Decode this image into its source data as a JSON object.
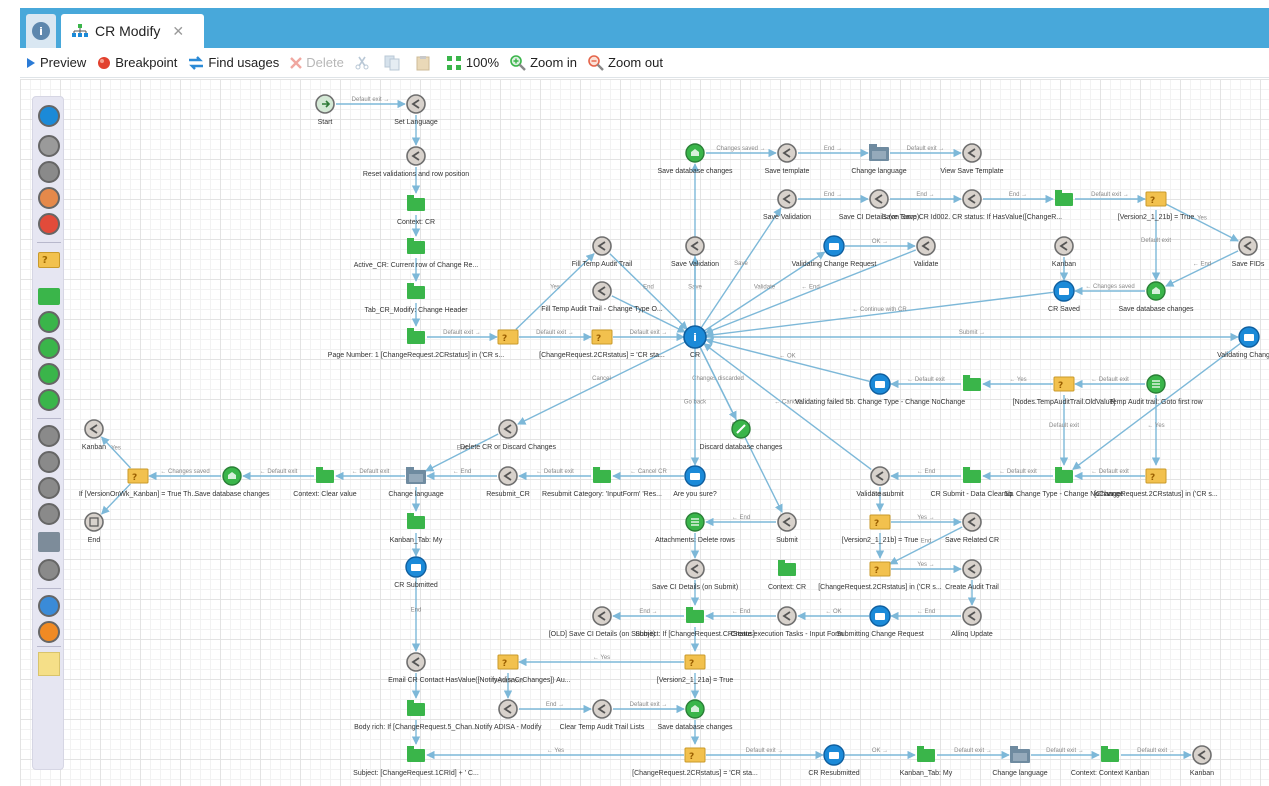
{
  "tabs": {
    "info_symbol": "i",
    "active_label": "CR Modify",
    "close_symbol": "✕"
  },
  "toolbar": {
    "preview": "Preview",
    "breakpoint": "Breakpoint",
    "find_usages": "Find usages",
    "delete": "Delete",
    "zoom_level": "100%",
    "zoom_in": "Zoom in",
    "zoom_out": "Zoom out"
  },
  "palette": {
    "items": [
      {
        "icon": "info-icon",
        "color": "#1b8ad8"
      },
      {
        "icon": "exit-icon",
        "color": "#9a9a9a"
      },
      {
        "icon": "back-icon",
        "color": "#8a8a8a"
      },
      {
        "icon": "refresh-icon",
        "color": "#e5894a"
      },
      {
        "icon": "logout-icon",
        "color": "#e24b3a"
      },
      {
        "icon": "decision-icon",
        "color": "#f2c14e"
      },
      {
        "icon": "context-icon",
        "color": "#3ab54a"
      },
      {
        "icon": "list-icon",
        "color": "#3ab54a"
      },
      {
        "icon": "loop-icon",
        "color": "#3ab54a"
      },
      {
        "icon": "database-icon",
        "color": "#3ab54a"
      },
      {
        "icon": "edit-icon",
        "color": "#3ab54a"
      },
      {
        "icon": "form-icon",
        "color": "#8a8a8a"
      },
      {
        "icon": "import-icon",
        "color": "#8a8a8a"
      },
      {
        "icon": "cloud-icon",
        "color": "#8a8a8a"
      },
      {
        "icon": "globe-icon",
        "color": "#8a8a8a"
      },
      {
        "icon": "folder-icon",
        "color": "#7d8c9a"
      },
      {
        "icon": "printer-icon",
        "color": "#8a8a8a"
      },
      {
        "icon": "link-icon",
        "color": "#3a8bd8"
      },
      {
        "icon": "wifi-icon",
        "color": "#f08a24"
      },
      {
        "icon": "note-icon",
        "color": "#f5df88"
      }
    ]
  },
  "colors": {
    "tabbar": "#48a8da",
    "edge": "#7db8d8",
    "hub": "#1b8ad8",
    "context": "#3ab54a",
    "decision": "#f2c14e",
    "back": "#8a8a8a"
  },
  "nodes": [
    {
      "id": "start",
      "type": "start",
      "label": "Start"
    },
    {
      "id": "setlang",
      "type": "back",
      "label": "Set Language"
    },
    {
      "id": "reset",
      "type": "back",
      "label": "Reset validations and row position"
    },
    {
      "id": "ctxcr",
      "type": "context",
      "label": "Context: CR"
    },
    {
      "id": "active",
      "type": "context",
      "label": "Active_CR: Current row of Change Re..."
    },
    {
      "id": "tabcr",
      "type": "context",
      "label": "Tab_CR_Modify: Change Header"
    },
    {
      "id": "pagenum",
      "type": "context",
      "label": "Page Number: 1 [ChangeRequest.2CRstatus] in ('CR s..."
    },
    {
      "id": "dec1",
      "type": "decision",
      "label": ""
    },
    {
      "id": "dec2",
      "type": "decision",
      "label": "[ChangeRequest.2CRstatus] = 'CR sta..."
    },
    {
      "id": "filltemp",
      "type": "back",
      "label": "Fill Temp Audit Trail"
    },
    {
      "id": "filltemp2",
      "type": "back",
      "label": "Fill Temp Audit Trail - Change Type O..."
    },
    {
      "id": "hub",
      "type": "hub",
      "label": "CR"
    },
    {
      "id": "savedb1",
      "type": "db",
      "label": "Save database changes"
    },
    {
      "id": "savetpl",
      "type": "back",
      "label": "Save template"
    },
    {
      "id": "chglang1",
      "type": "folder",
      "label": "Change language"
    },
    {
      "id": "viewsave",
      "type": "back",
      "label": "View Save Template"
    },
    {
      "id": "saveval1",
      "type": "back",
      "label": "Save Validation"
    },
    {
      "id": "saveval2",
      "type": "back",
      "label": "Save Validation"
    },
    {
      "id": "saveci",
      "type": "back",
      "label": "Save CI Details (on Save)"
    },
    {
      "id": "savetemp",
      "type": "back",
      "label": "Save Temp CR Id002. CR status: If HasValue([ChangeR..."
    },
    {
      "id": "ctxsave",
      "type": "context",
      "label": ""
    },
    {
      "id": "decsave",
      "type": "decision",
      "label": "[Version2_1_21b] = True"
    },
    {
      "id": "savefids",
      "type": "back",
      "label": "Save FIDs"
    },
    {
      "id": "valchg",
      "type": "screen",
      "label": "Validating Change Request"
    },
    {
      "id": "validate",
      "type": "back",
      "label": "Validate"
    },
    {
      "id": "kanban1",
      "type": "back",
      "label": "Kanban"
    },
    {
      "id": "crsaved",
      "type": "screen",
      "label": "CR Saved"
    },
    {
      "id": "savedb2",
      "type": "db",
      "label": "Save database changes"
    },
    {
      "id": "valchg2",
      "type": "screen",
      "label": "Validating Change R"
    },
    {
      "id": "valfail",
      "type": "screen",
      "label": "Validating failed 5b. Change Type - Change NoChange"
    },
    {
      "id": "ctxval",
      "type": "context",
      "label": ""
    },
    {
      "id": "decval",
      "type": "decision",
      "label": "[Nodes.TempAuditTrail.OldValue]"
    },
    {
      "id": "auditfirst",
      "type": "list",
      "label": "Temp Audit trail: Goto first row"
    },
    {
      "id": "delcr",
      "type": "back",
      "label": "Delete CR or Discard Changes"
    },
    {
      "id": "discard",
      "type": "edit",
      "label": "Discard database changes"
    },
    {
      "id": "kanban2",
      "type": "back",
      "label": "Kanban"
    },
    {
      "id": "ifkanban",
      "type": "decision",
      "label": "If [VersionOnWk_Kanban] = True Th..."
    },
    {
      "id": "endnode",
      "type": "end",
      "label": "End"
    },
    {
      "id": "savedb3",
      "type": "db",
      "label": "Save database changes"
    },
    {
      "id": "ctxclear",
      "type": "context",
      "label": "Context: Clear value"
    },
    {
      "id": "chglang2",
      "type": "folder",
      "label": "Change language"
    },
    {
      "id": "resubmit",
      "type": "back",
      "label": "Resubmit_CR"
    },
    {
      "id": "resubcat",
      "type": "context",
      "label": "Resubmit Category: 'InputForm' 'Res..."
    },
    {
      "id": "areyou",
      "type": "screen",
      "label": "Are you sure?"
    },
    {
      "id": "valsubmit",
      "type": "back",
      "label": "Validate submit"
    },
    {
      "id": "crsubmit",
      "type": "context",
      "label": "CR Submit - Data Cleanup"
    },
    {
      "id": "chgtype",
      "type": "context",
      "label": "5b. Change Type - Change NoChange"
    },
    {
      "id": "decreq",
      "type": "decision",
      "label": "[ChangeRequest.2CRstatus] in ('CR s..."
    },
    {
      "id": "kanbantab",
      "type": "context",
      "label": "Kanban_Tab: My"
    },
    {
      "id": "crsubmitted",
      "type": "screen",
      "label": "CR Submitted"
    },
    {
      "id": "attach",
      "type": "list",
      "label": "Attachments: Delete rows"
    },
    {
      "id": "submit",
      "type": "back",
      "label": "Submit"
    },
    {
      "id": "decver",
      "type": "decision",
      "label": "[Version2_1_21b] = True"
    },
    {
      "id": "saverel",
      "type": "back",
      "label": "Save Related CR"
    },
    {
      "id": "decreq2",
      "type": "decision",
      "label": "[ChangeRequest.2CRstatus] in ('CR s..."
    },
    {
      "id": "createaudit",
      "type": "back",
      "label": "Create Audit Trail"
    },
    {
      "id": "saveci2",
      "type": "back",
      "label": "Save CI Details (on Submit)"
    },
    {
      "id": "ctxcr2",
      "type": "context",
      "label": "Context: CR"
    },
    {
      "id": "oldsave",
      "type": "back",
      "label": "[OLD] Save CI Details (on Submit)"
    },
    {
      "id": "subject1",
      "type": "context",
      "label": "Subject: If [ChangeRequest.CRStatus]"
    },
    {
      "id": "createexec",
      "type": "back",
      "label": "Create execution Tasks - Input Form"
    },
    {
      "id": "submitting",
      "type": "screen",
      "label": "Submitting Change Request"
    },
    {
      "id": "allinq",
      "type": "back",
      "label": "Allinq Update"
    },
    {
      "id": "email",
      "type": "back",
      "label": "Email CR Contact"
    },
    {
      "id": "decnotify",
      "type": "decision",
      "label": "HasValue([NotifyAdisaCrChanges]) Au..."
    },
    {
      "id": "decv21",
      "type": "decision",
      "label": "[Version2_1_21a] = True"
    },
    {
      "id": "body",
      "type": "context",
      "label": "Body rich: If [ChangeRequest.5_Chan..."
    },
    {
      "id": "notify",
      "type": "back",
      "label": "Notify ADISA - Modify"
    },
    {
      "id": "cleartemp",
      "type": "back",
      "label": "Clear Temp Audit Trail Lists"
    },
    {
      "id": "savedb4",
      "type": "db",
      "label": "Save database changes"
    },
    {
      "id": "subject2",
      "type": "context",
      "label": "Subject: [ChangeRequest.1CRId] + ' C..."
    },
    {
      "id": "decstatus",
      "type": "decision",
      "label": "[ChangeRequest.2CRstatus] = 'CR sta..."
    },
    {
      "id": "crresub",
      "type": "screen",
      "label": "CR Resubmitted"
    },
    {
      "id": "kanbantab2",
      "type": "context",
      "label": "Kanban_Tab: My"
    },
    {
      "id": "chglang3",
      "type": "folder",
      "label": "Change language"
    },
    {
      "id": "ctxkanban",
      "type": "context",
      "label": "Context: Context Kanban"
    },
    {
      "id": "kanban3",
      "type": "back",
      "label": "Kanban"
    }
  ],
  "edges": [
    {
      "from": "start",
      "to": "setlang",
      "label": "Default exit →"
    },
    {
      "from": "setlang",
      "to": "reset",
      "label": ""
    },
    {
      "from": "reset",
      "to": "ctxcr",
      "label": ""
    },
    {
      "from": "ctxcr",
      "to": "active",
      "label": ""
    },
    {
      "from": "active",
      "to": "tabcr",
      "label": ""
    },
    {
      "from": "tabcr",
      "to": "pagenum",
      "label": ""
    },
    {
      "from": "pagenum",
      "to": "dec1",
      "label": "Default exit →"
    },
    {
      "from": "dec1",
      "to": "dec2",
      "label": "Default exit →"
    },
    {
      "from": "dec2",
      "to": "hub",
      "label": "Default exit →"
    },
    {
      "from": "dec1",
      "to": "filltemp",
      "label": "Yes"
    },
    {
      "from": "filltemp",
      "to": "hub",
      "label": "End"
    },
    {
      "from": "filltemp2",
      "to": "hub",
      "label": ""
    },
    {
      "from": "hub",
      "to": "saveval1",
      "label": "Save"
    },
    {
      "from": "savedb1",
      "to": "savetpl",
      "label": "Changes saved →"
    },
    {
      "from": "savetpl",
      "to": "chglang1",
      "label": "End →"
    },
    {
      "from": "chglang1",
      "to": "viewsave",
      "label": "Default exit →"
    },
    {
      "from": "hub",
      "to": "savedb1",
      "label": "End"
    },
    {
      "from": "hub",
      "to": "saveval2",
      "label": "Save"
    },
    {
      "from": "saveval2",
      "to": "saveci",
      "label": "End →"
    },
    {
      "from": "saveci",
      "to": "savetemp",
      "label": "End →"
    },
    {
      "from": "savetemp",
      "to": "ctxsave",
      "label": "End →"
    },
    {
      "from": "ctxsave",
      "to": "decsave",
      "label": "Default exit →"
    },
    {
      "from": "decsave",
      "to": "savefids",
      "label": "Yes"
    },
    {
      "from": "decsave",
      "to": "savedb2",
      "label": "Default exit"
    },
    {
      "from": "savefids",
      "to": "savedb2",
      "label": "← End"
    },
    {
      "from": "savedb2",
      "to": "crsaved",
      "label": "← Changes saved"
    },
    {
      "from": "crsaved",
      "to": "hub",
      "label": "← Continue with CR"
    },
    {
      "from": "kanban1",
      "to": "crsaved",
      "label": ""
    },
    {
      "from": "hub",
      "to": "valchg",
      "label": "Validate"
    },
    {
      "from": "valchg",
      "to": "validate",
      "label": "OK →"
    },
    {
      "from": "validate",
      "to": "hub",
      "label": "← End"
    },
    {
      "from": "hub",
      "to": "valchg2",
      "label": "Submit →"
    },
    {
      "from": "valchg2",
      "to": "chgtype",
      "label": ""
    },
    {
      "from": "auditfirst",
      "to": "decval",
      "label": "← Default exit"
    },
    {
      "from": "decval",
      "to": "ctxval",
      "label": "← Yes"
    },
    {
      "from": "ctxval",
      "to": "valfail",
      "label": "← Default exit"
    },
    {
      "from": "valfail",
      "to": "hub",
      "label": "← OK"
    },
    {
      "from": "decval",
      "to": "chgtype",
      "label": "Default exit"
    },
    {
      "from": "auditfirst",
      "to": "decreq",
      "label": "← Yes"
    },
    {
      "from": "decreq",
      "to": "chgtype",
      "label": "← Default exit"
    },
    {
      "from": "chgtype",
      "to": "crsubmit",
      "label": "← Default exit"
    },
    {
      "from": "crsubmit",
      "to": "valsubmit",
      "label": "← End"
    },
    {
      "from": "valsubmit",
      "to": "hub",
      "label": "← Cancel"
    },
    {
      "from": "valsubmit",
      "to": "decver",
      "label": "Failed"
    },
    {
      "from": "hub",
      "to": "delcr",
      "label": "Cancel"
    },
    {
      "from": "delcr",
      "to": "chglang2",
      "label": "End"
    },
    {
      "from": "hub",
      "to": "discard",
      "label": "Changes discarded"
    },
    {
      "from": "hub",
      "to": "areyou",
      "label": "Go back"
    },
    {
      "from": "areyou",
      "to": "resubcat",
      "label": "← Cancel CR"
    },
    {
      "from": "resubcat",
      "to": "resubmit",
      "label": "← Default exit"
    },
    {
      "from": "resubmit",
      "to": "chglang2",
      "label": "← End"
    },
    {
      "from": "chglang2",
      "to": "ctxclear",
      "label": "← Default exit"
    },
    {
      "from": "ctxclear",
      "to": "savedb3",
      "label": "← Default exit"
    },
    {
      "from": "savedb3",
      "to": "ifkanban",
      "label": "← Changes saved"
    },
    {
      "from": "ifkanban",
      "to": "kanban2",
      "label": "Yes"
    },
    {
      "from": "ifkanban",
      "to": "endnode",
      "label": ""
    },
    {
      "from": "chglang2",
      "to": "kanbantab",
      "label": ""
    },
    {
      "from": "kanbantab",
      "to": "crsubmitted",
      "label": ""
    },
    {
      "from": "crsubmitted",
      "to": "email",
      "label": "End"
    },
    {
      "from": "hub",
      "to": "submit",
      "label": "Cancel"
    },
    {
      "from": "submit",
      "to": "attach",
      "label": "← End"
    },
    {
      "from": "attach",
      "to": "saveci2",
      "label": ""
    },
    {
      "from": "saveci2",
      "to": "subject1",
      "label": ""
    },
    {
      "from": "decver",
      "to": "saverel",
      "label": "Yes →"
    },
    {
      "from": "decver",
      "to": "decreq2",
      "label": ""
    },
    {
      "from": "saverel",
      "to": "decreq2",
      "label": "End"
    },
    {
      "from": "decreq2",
      "to": "createaudit",
      "label": "Yes →"
    },
    {
      "from": "createaudit",
      "to": "allinq",
      "label": ""
    },
    {
      "from": "allinq",
      "to": "submitting",
      "label": "← End"
    },
    {
      "from": "submitting",
      "to": "createexec",
      "label": "← OK"
    },
    {
      "from": "createexec",
      "to": "subject1",
      "label": "← End"
    },
    {
      "from": "subject1",
      "to": "oldsave",
      "label": "End →"
    },
    {
      "from": "subject1",
      "to": "decv21",
      "label": ""
    },
    {
      "from": "decv21",
      "to": "decnotify",
      "label": "← Yes"
    },
    {
      "from": "decnotify",
      "to": "notify",
      "label": "Default exit"
    },
    {
      "from": "notify",
      "to": "cleartemp",
      "label": "End →"
    },
    {
      "from": "cleartemp",
      "to": "savedb4",
      "label": "Default exit →"
    },
    {
      "from": "decv21",
      "to": "savedb4",
      "label": ""
    },
    {
      "from": "email",
      "to": "body",
      "label": ""
    },
    {
      "from": "body",
      "to": "subject2",
      "label": ""
    },
    {
      "from": "savedb4",
      "to": "decstatus",
      "label": ""
    },
    {
      "from": "decstatus",
      "to": "subject2",
      "label": "← Yes"
    },
    {
      "from": "decstatus",
      "to": "crresub",
      "label": "Default exit →"
    },
    {
      "from": "crresub",
      "to": "kanbantab2",
      "label": "OK →"
    },
    {
      "from": "kanbantab2",
      "to": "chglang3",
      "label": "Default exit →"
    },
    {
      "from": "chglang3",
      "to": "ctxkanban",
      "label": "Default exit →"
    },
    {
      "from": "ctxkanban",
      "to": "kanban3",
      "label": "Default exit →"
    }
  ]
}
